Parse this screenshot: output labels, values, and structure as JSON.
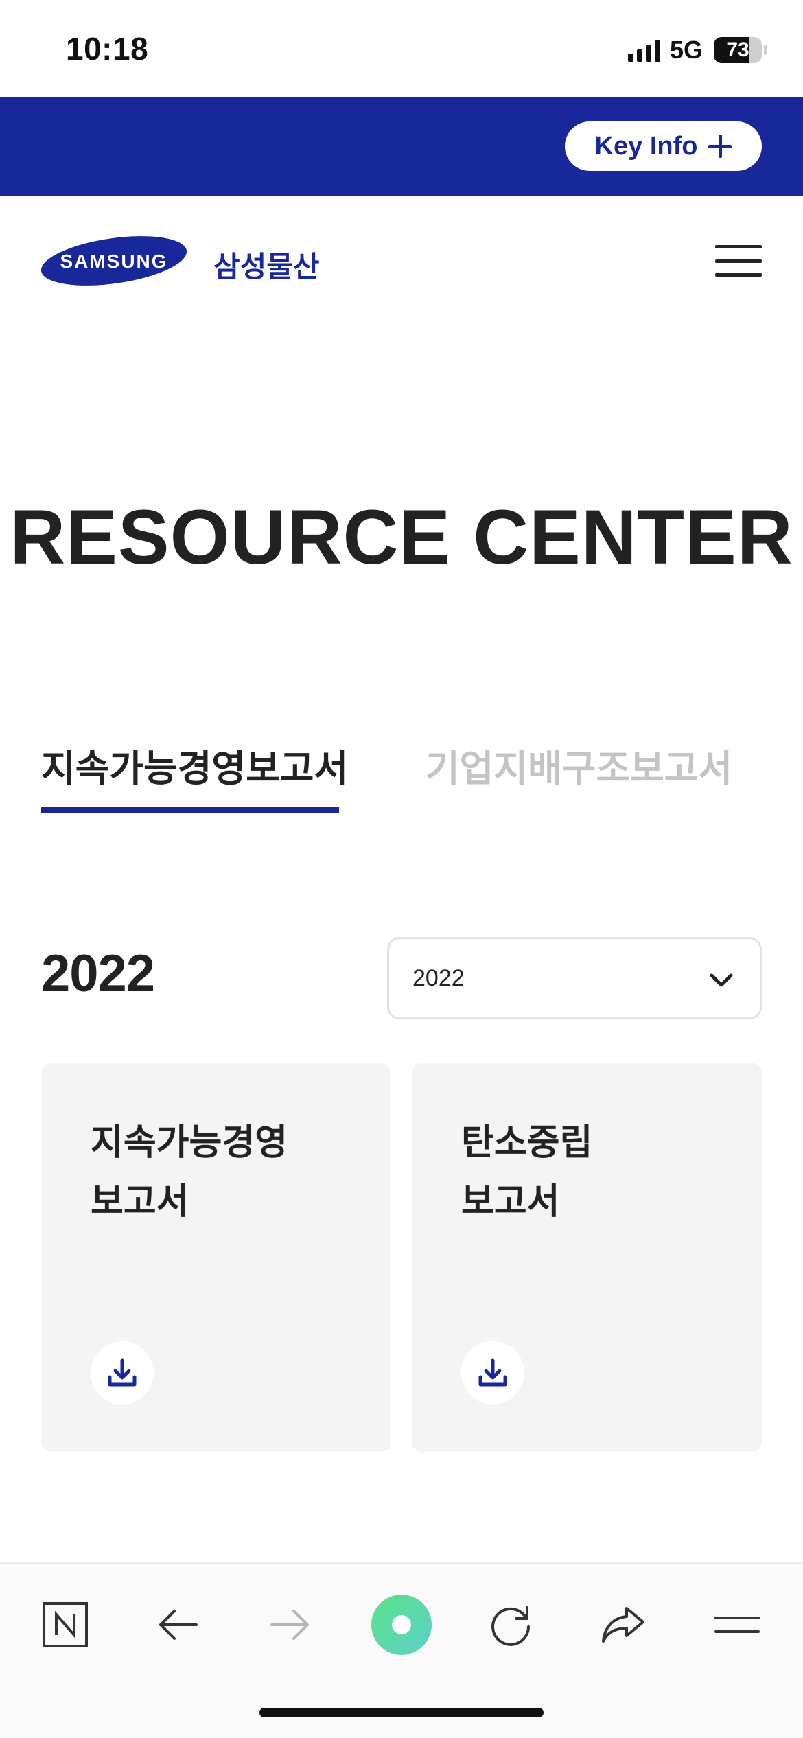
{
  "status_bar": {
    "time": "10:18",
    "network": "5G",
    "battery_percent": "73"
  },
  "topbar": {
    "key_info_label": "Key Info",
    "background_color": "#18279a"
  },
  "header": {
    "logo_text": "SAMSUNG",
    "brand_korean": "삼성물산",
    "menu_icon": "hamburger-menu-icon"
  },
  "main": {
    "title": "RESOURCE CENTER",
    "tabs": [
      {
        "label": "지속가능경영보고서",
        "active": true
      },
      {
        "label": "기업지배구조보고서",
        "active": false
      }
    ],
    "year_heading": "2022",
    "year_select": {
      "selected": "2022"
    },
    "cards": [
      {
        "title_line1": "지속가능경영",
        "title_line2": "보고서",
        "icon": "download-icon"
      },
      {
        "title_line1": "탄소중립",
        "title_line2": "보고서",
        "icon": "download-icon"
      }
    ]
  },
  "browser_toolbar": {
    "items": [
      "naver-n-icon",
      "back-arrow-icon",
      "forward-arrow-icon",
      "green-dot-icon",
      "refresh-icon",
      "share-icon",
      "menu-lines-icon"
    ]
  },
  "colors": {
    "brand_blue": "#18279a",
    "card_bg": "#f4f4f4",
    "inactive_tab": "#c4c4c4"
  }
}
